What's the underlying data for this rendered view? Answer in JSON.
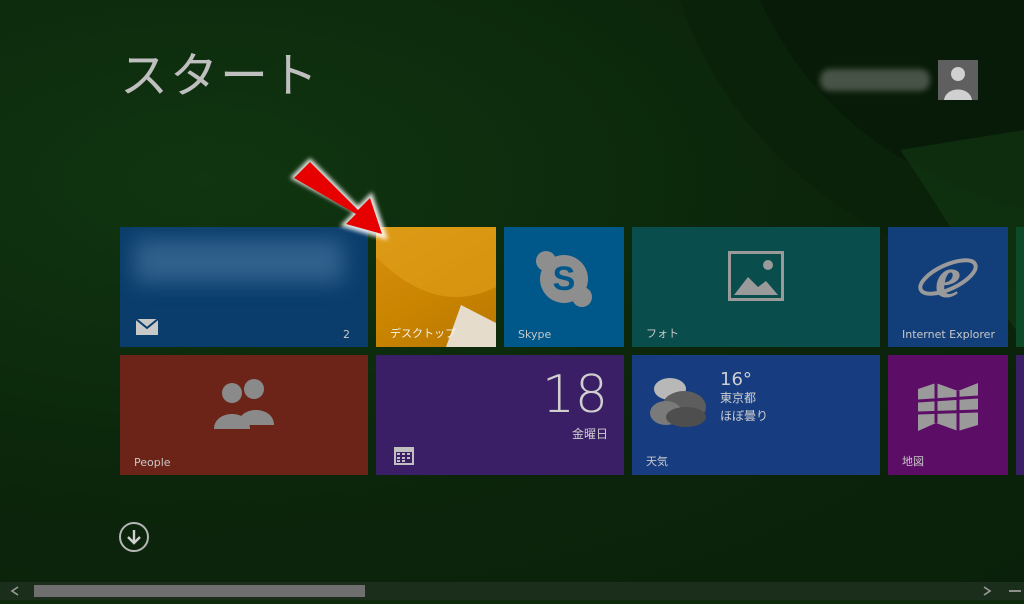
{
  "start": {
    "title": "スタート"
  },
  "user": {
    "name": ""
  },
  "tiles": {
    "mail": {
      "label": "",
      "count": "2"
    },
    "desktop": {
      "label": "デスクトップ"
    },
    "skype": {
      "label": "Skype"
    },
    "photos": {
      "label": "フォト"
    },
    "ie": {
      "label": "Internet Explorer"
    },
    "people": {
      "label": "People"
    },
    "calendar": {
      "day": "18",
      "weekday": "金曜日"
    },
    "weather": {
      "label": "天気",
      "temperature": "16°",
      "city": "東京都",
      "condition": "ほぼ曇り"
    },
    "maps": {
      "label": "地図"
    }
  },
  "colors": {
    "mail": "#0a3d6b",
    "desktop": "#c98400",
    "skype": "#00578a",
    "photos": "#0a4d4d",
    "ie": "#123f7a",
    "people": "#6b2417",
    "calendar": "#3b1f66",
    "weather": "#173d80",
    "maps": "#5c0d66",
    "annotation_arrow": "#e60000"
  },
  "icons": [
    "mail-icon",
    "skype-icon",
    "photo-icon",
    "ie-icon",
    "people-icon",
    "calendar-icon",
    "weather-icon",
    "maps-icon",
    "down-arrow-icon",
    "avatar-icon"
  ]
}
